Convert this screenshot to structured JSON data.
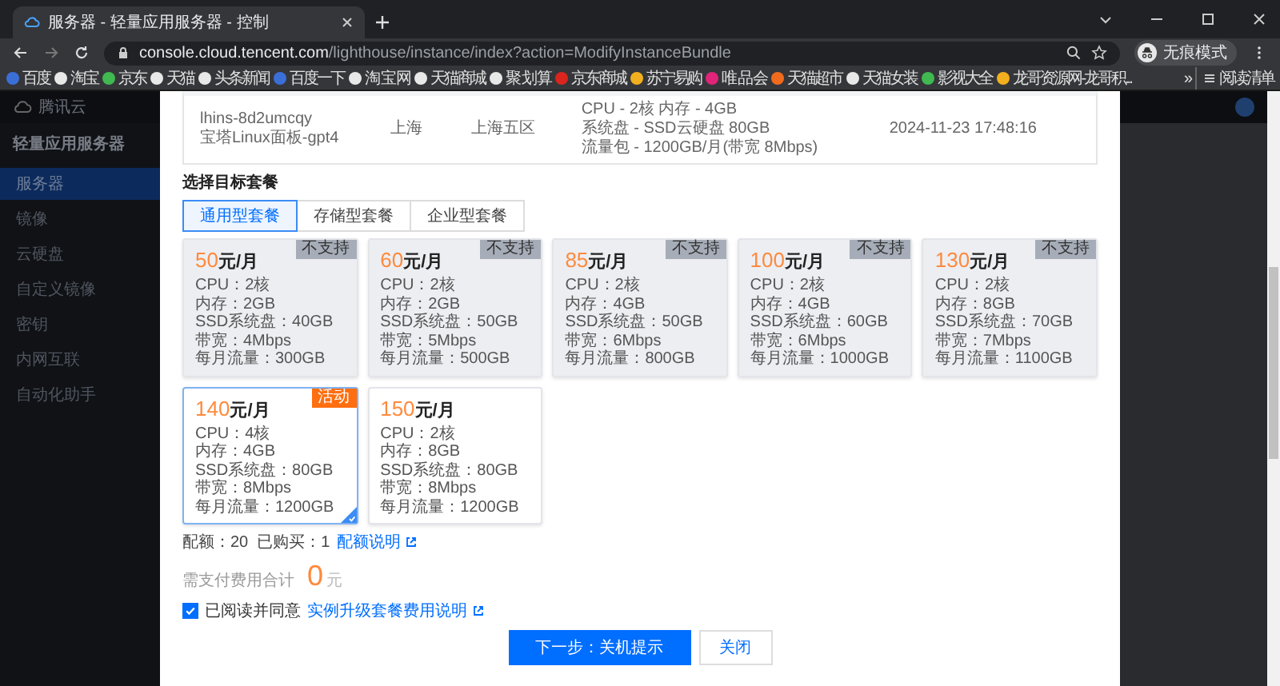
{
  "browser": {
    "tab_title": "服务器 - 轻量应用服务器 - 控制",
    "url_host": "console.cloud.tencent.com",
    "url_path": "/lighthouse/instance/index?action=ModifyInstanceBundle",
    "profile_label": "无痕模式",
    "bookmarks": [
      {
        "label": "百度",
        "color": "#3b6fd8"
      },
      {
        "label": "淘宝",
        "color": "#e8e8e8"
      },
      {
        "label": "京东",
        "color": "#3fb950"
      },
      {
        "label": "天猫",
        "color": "#e8e8e8"
      },
      {
        "label": "头条新闻",
        "color": "#e8e8e8"
      },
      {
        "label": "百度一下",
        "color": "#3b6fd8"
      },
      {
        "label": "淘 宝 网",
        "color": "#e8e8e8"
      },
      {
        "label": "天猫商城",
        "color": "#e8e8e8"
      },
      {
        "label": "聚 划 算",
        "color": "#e8e8e8"
      },
      {
        "label": "京东商城",
        "color": "#d9251d"
      },
      {
        "label": "苏宁易购",
        "color": "#f2b01e"
      },
      {
        "label": "唯 品 会",
        "color": "#e0247a"
      },
      {
        "label": "天猫超市",
        "color": "#f26b1d"
      },
      {
        "label": "天猫女装",
        "color": "#e8e8e8"
      },
      {
        "label": "影视大全",
        "color": "#3fb950"
      },
      {
        "label": "龙哥资源网-龙哥积...",
        "color": "#f2b01e"
      }
    ],
    "overflow": "»",
    "reading_list": "阅读清单"
  },
  "console": {
    "brand": "腾讯云",
    "sidebar_title": "轻量应用服务器",
    "sidebar_items": [
      {
        "label": "服务器",
        "selected": true
      },
      {
        "label": "镜像",
        "selected": false
      },
      {
        "label": "云硬盘",
        "selected": false
      },
      {
        "label": "自定义镜像",
        "selected": false
      },
      {
        "label": "密钥",
        "selected": false
      },
      {
        "label": "内网互联",
        "selected": false
      },
      {
        "label": "自动化助手",
        "selected": false
      }
    ]
  },
  "dialog": {
    "instance": {
      "id": "lhins-8d2umcqy",
      "name": "宝塔Linux面板-gpt4",
      "region": "上海",
      "zone": "上海五区",
      "spec_lines": [
        "CPU - 2核 内存 - 4GB",
        "系统盘 - SSD云硬盘 80GB",
        "流量包 - 1200GB/月(带宽 8Mbps)"
      ],
      "created": "2024-11-23 17:48:16"
    },
    "section_title": "选择目标套餐",
    "plan_tabs": [
      {
        "label": "通用型套餐",
        "selected": true
      },
      {
        "label": "存储型套餐",
        "selected": false
      },
      {
        "label": "企业型套餐",
        "selected": false
      }
    ],
    "plans": [
      {
        "price": "50",
        "unit": "元/月",
        "specs": [
          "CPU：2核",
          "内存：2GB",
          "SSD系统盘：40GB",
          "带宽：4Mbps",
          "每月流量：300GB"
        ],
        "badge": {
          "kind": "unsupported",
          "label": "不支持"
        },
        "disabled": true,
        "selected": false
      },
      {
        "price": "60",
        "unit": "元/月",
        "specs": [
          "CPU：2核",
          "内存：2GB",
          "SSD系统盘：50GB",
          "带宽：5Mbps",
          "每月流量：500GB"
        ],
        "badge": {
          "kind": "unsupported",
          "label": "不支持"
        },
        "disabled": true,
        "selected": false
      },
      {
        "price": "85",
        "unit": "元/月",
        "specs": [
          "CPU：2核",
          "内存：4GB",
          "SSD系统盘：50GB",
          "带宽：6Mbps",
          "每月流量：800GB"
        ],
        "badge": {
          "kind": "unsupported",
          "label": "不支持"
        },
        "disabled": true,
        "selected": false
      },
      {
        "price": "100",
        "unit": "元/月",
        "specs": [
          "CPU：2核",
          "内存：4GB",
          "SSD系统盘：60GB",
          "带宽：6Mbps",
          "每月流量：1000GB"
        ],
        "badge": {
          "kind": "unsupported",
          "label": "不支持"
        },
        "disabled": true,
        "selected": false
      },
      {
        "price": "130",
        "unit": "元/月",
        "specs": [
          "CPU：2核",
          "内存：8GB",
          "SSD系统盘：70GB",
          "带宽：7Mbps",
          "每月流量：1100GB"
        ],
        "badge": {
          "kind": "unsupported",
          "label": "不支持"
        },
        "disabled": true,
        "selected": false
      },
      {
        "price": "140",
        "unit": "元/月",
        "specs": [
          "CPU：4核",
          "内存：4GB",
          "SSD系统盘：80GB",
          "带宽：8Mbps",
          "每月流量：1200GB"
        ],
        "badge": {
          "kind": "promo",
          "label": "活动"
        },
        "disabled": false,
        "selected": true
      },
      {
        "price": "150",
        "unit": "元/月",
        "specs": [
          "CPU：2核",
          "内存：8GB",
          "SSD系统盘：80GB",
          "带宽：8Mbps",
          "每月流量：1200GB"
        ],
        "disabled": false,
        "selected": false
      }
    ],
    "quota": {
      "text": "配额：20  已购买：1",
      "link": "配额说明"
    },
    "total": {
      "label": "需支付费用合计",
      "amount": "0",
      "unit": "元"
    },
    "agreement": {
      "checked": true,
      "text": "已阅读并同意",
      "link": "实例升级套餐费用说明"
    },
    "buttons": [
      {
        "label": "下一步：关机提示",
        "kind": "primary"
      },
      {
        "label": "关闭",
        "kind": "default"
      }
    ]
  }
}
